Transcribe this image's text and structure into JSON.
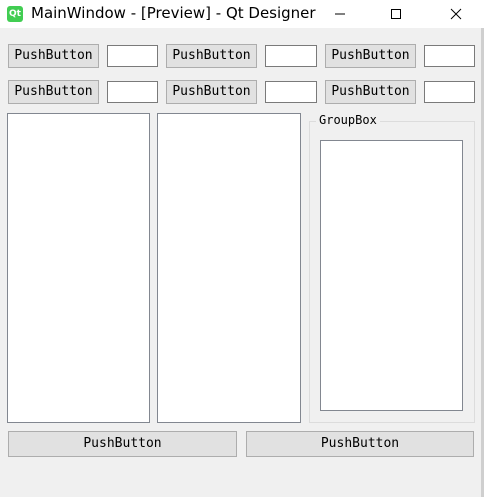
{
  "window": {
    "title": "MainWindow - [Preview] - Qt Designer",
    "app_icon_label": "Qt",
    "accent_color": "#41cd52"
  },
  "controls": {
    "minimize_icon": "minimize-icon",
    "maximize_icon": "maximize-icon",
    "close_icon": "close-icon"
  },
  "grid": {
    "rows": [
      {
        "buttons": [
          "PushButton",
          "PushButton",
          "PushButton"
        ],
        "line_edits": [
          "",
          "",
          ""
        ]
      },
      {
        "buttons": [
          "PushButton",
          "PushButton",
          "PushButton"
        ],
        "line_edits": [
          "",
          "",
          ""
        ]
      }
    ]
  },
  "groupbox": {
    "title": "GroupBox"
  },
  "bottom": {
    "left_button": "PushButton",
    "right_button": "PushButton"
  }
}
